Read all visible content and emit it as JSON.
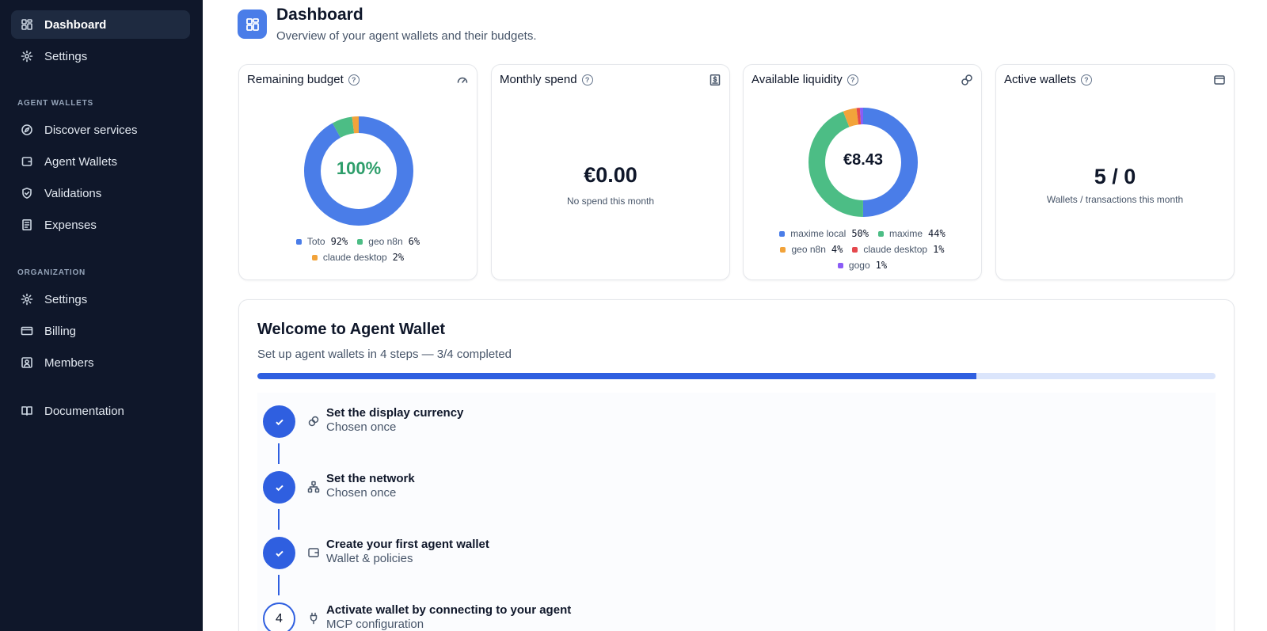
{
  "sidebar": {
    "top_items": [
      {
        "label": "Dashboard",
        "icon": "dashboard-icon",
        "active": true
      },
      {
        "label": "Settings",
        "icon": "gear-icon"
      }
    ],
    "agent_wallets_heading": "AGENT WALLETS",
    "agent_items": [
      {
        "label": "Discover services",
        "icon": "compass-icon"
      },
      {
        "label": "Agent Wallets",
        "icon": "wallet-icon"
      },
      {
        "label": "Validations",
        "icon": "shield-check-icon"
      },
      {
        "label": "Expenses",
        "icon": "receipt-icon"
      }
    ],
    "organization_heading": "ORGANIZATION",
    "org_items": [
      {
        "label": "Settings",
        "icon": "gear-icon"
      },
      {
        "label": "Billing",
        "icon": "credit-card-icon"
      },
      {
        "label": "Members",
        "icon": "user-square-icon"
      }
    ],
    "documentation": {
      "label": "Documentation",
      "icon": "book-icon"
    }
  },
  "header": {
    "title": "Dashboard",
    "subtitle": "Overview of your agent wallets and their budgets."
  },
  "cards": {
    "remaining_budget": {
      "title": "Remaining budget",
      "center": "100%",
      "center_color": "#2e9e6b",
      "segments": [
        {
          "name": "Toto",
          "pct": 92,
          "label": "92%",
          "color": "#4a7de8"
        },
        {
          "name": "geo n8n",
          "pct": 6,
          "label": "6%",
          "color": "#4cbd85"
        },
        {
          "name": "claude desktop",
          "pct": 2,
          "label": "2%",
          "color": "#f2a33a"
        }
      ]
    },
    "monthly_spend": {
      "title": "Monthly spend",
      "value": "€0.00",
      "caption": "No spend this month"
    },
    "available_liquidity": {
      "title": "Available liquidity",
      "center": "€8.43",
      "segments": [
        {
          "name": "maxime local",
          "pct": 50,
          "label": "50%",
          "color": "#4a7de8"
        },
        {
          "name": "maxime",
          "pct": 44,
          "label": "44%",
          "color": "#4cbd85"
        },
        {
          "name": "geo n8n",
          "pct": 4,
          "label": "4%",
          "color": "#f2a33a"
        },
        {
          "name": "claude desktop",
          "pct": 1,
          "label": "1%",
          "color": "#e5484d"
        },
        {
          "name": "gogo",
          "pct": 1,
          "label": "1%",
          "color": "#8b5cf6"
        }
      ]
    },
    "active_wallets": {
      "title": "Active wallets",
      "value": "5 / 0",
      "caption": "Wallets / transactions this month"
    }
  },
  "welcome": {
    "title": "Welcome to Agent Wallet",
    "subtitle": "Set up agent wallets in 4 steps — 3/4 completed",
    "progress": 0.75,
    "steps": [
      {
        "title": "Set the display currency",
        "subtitle": "Chosen once",
        "done": true,
        "icon": "coins-icon"
      },
      {
        "title": "Set the network",
        "subtitle": "Chosen once",
        "done": true,
        "icon": "network-icon"
      },
      {
        "title": "Create your first agent wallet",
        "subtitle": "Wallet & policies",
        "done": true,
        "icon": "wallet-icon"
      },
      {
        "title": "Activate wallet by connecting to your agent",
        "subtitle": "MCP configuration",
        "done": false,
        "number": "4",
        "icon": "plug-icon"
      }
    ]
  },
  "colors": {
    "sidebar_bg": "#0f172a",
    "accent": "#2f5fe0",
    "progress_track": "#dbe5fb"
  }
}
